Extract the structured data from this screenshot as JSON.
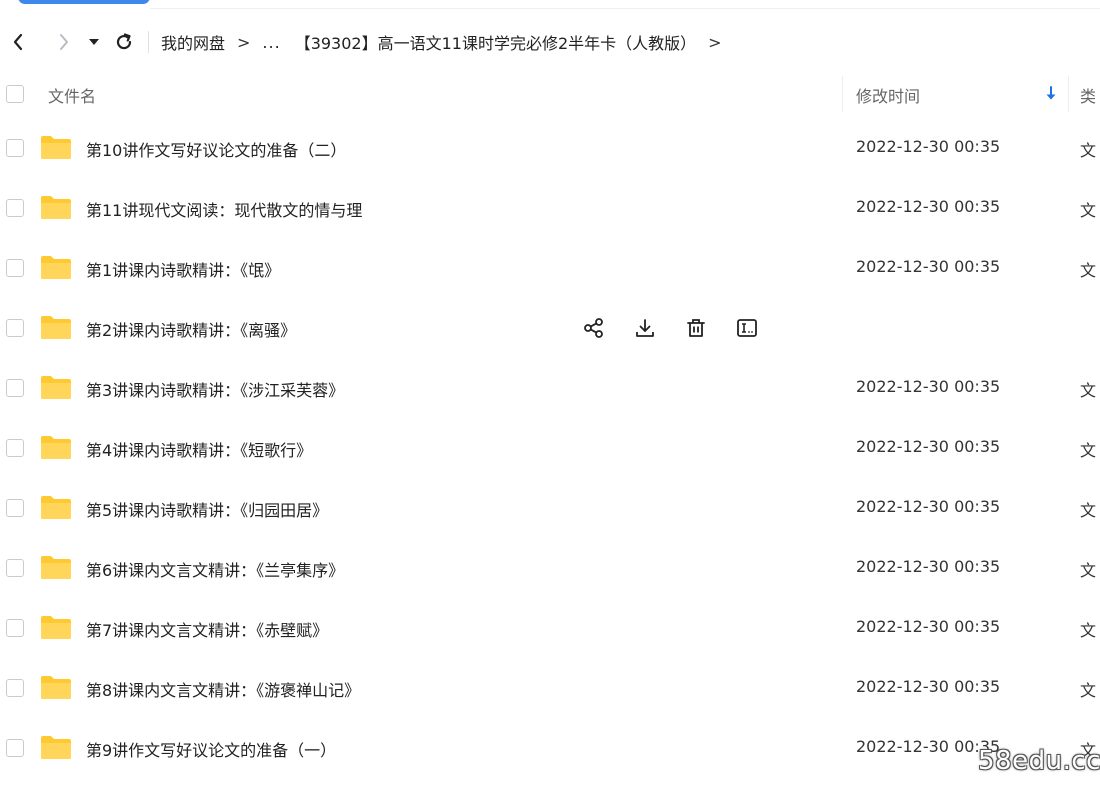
{
  "breadcrumb": {
    "root": "我的网盘",
    "sep": ">",
    "ellipsis": "...",
    "current": "【39302】高一语文11课时学完必修2半年卡（人教版）"
  },
  "header": {
    "name_label": "文件名",
    "mtime_label": "修改时间",
    "type_label": "类"
  },
  "files": [
    {
      "name": "第10讲作文写好议论文的准备（二）",
      "time": "2022-12-30 00:35",
      "type": "文"
    },
    {
      "name": "第11讲现代文阅读：现代散文的情与理",
      "time": "2022-12-30 00:35",
      "type": "文"
    },
    {
      "name": "第1讲课内诗歌精讲：《氓》",
      "time": "2022-12-30 00:35",
      "type": "文"
    },
    {
      "name": "第2讲课内诗歌精讲：《离骚》",
      "time": "",
      "type": ""
    },
    {
      "name": "第3讲课内诗歌精讲：《涉江采芙蓉》",
      "time": "2022-12-30 00:35",
      "type": "文"
    },
    {
      "name": "第4讲课内诗歌精讲：《短歌行》",
      "time": "2022-12-30 00:35",
      "type": "文"
    },
    {
      "name": "第5讲课内诗歌精讲：《归园田居》",
      "time": "2022-12-30 00:35",
      "type": "文"
    },
    {
      "name": "第6讲课内文言文精讲：《兰亭集序》",
      "time": "2022-12-30 00:35",
      "type": "文"
    },
    {
      "name": "第7讲课内文言文精讲：《赤壁赋》",
      "time": "2022-12-30 00:35",
      "type": "文"
    },
    {
      "name": "第8讲课内文言文精讲：《游褒禅山记》",
      "time": "2022-12-30 00:35",
      "type": "文"
    },
    {
      "name": "第9讲作文写好议论文的准备（一）",
      "time": "2022-12-30 00:35",
      "type": "文"
    }
  ],
  "hover_actions": [
    "share-icon",
    "download-icon",
    "delete-icon",
    "rename-icon"
  ],
  "watermark": "58edu.cc",
  "colors": {
    "folder": "#ffc933",
    "accent": "#1a73e8",
    "text": "#222222"
  }
}
